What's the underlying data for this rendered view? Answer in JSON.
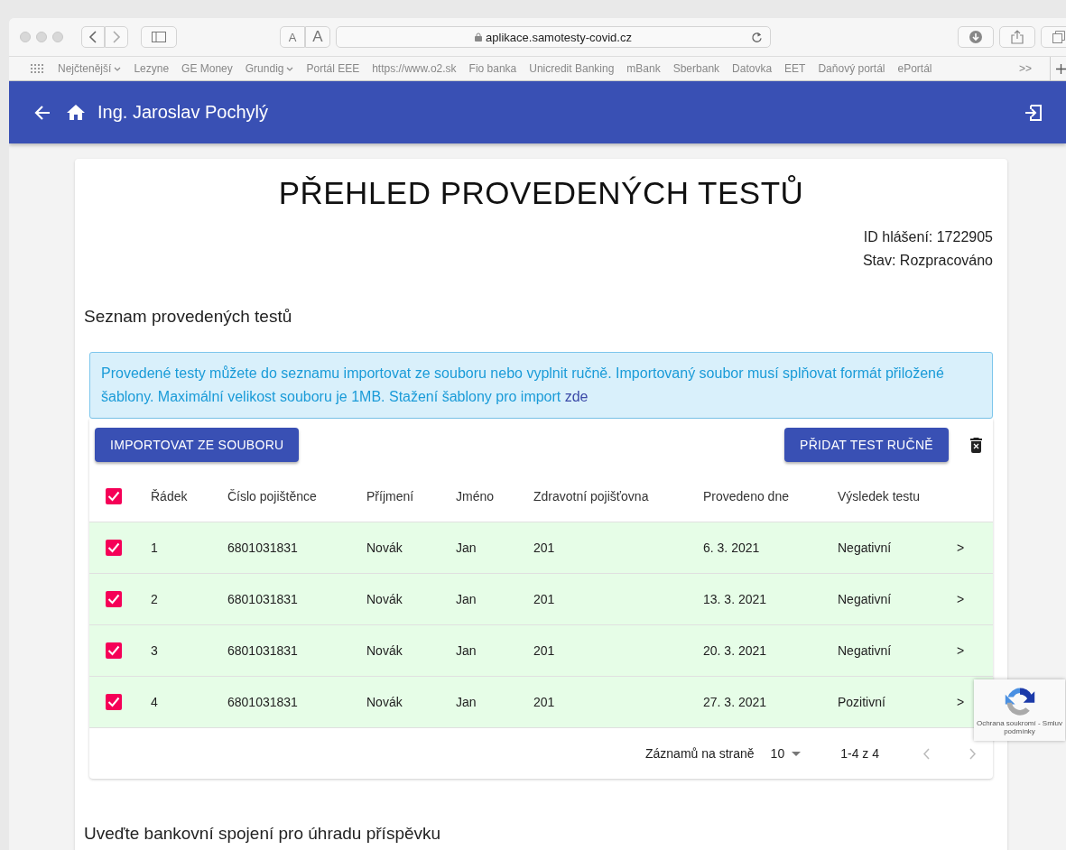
{
  "browser": {
    "url": "aplikace.samotesty-covid.cz",
    "font_small": "A",
    "font_large": "A",
    "bookmarks": [
      {
        "label": "Nejčtenější",
        "menu": true
      },
      {
        "label": "Lezyne",
        "menu": false
      },
      {
        "label": "GE Money",
        "menu": false
      },
      {
        "label": "Grundig",
        "menu": true
      },
      {
        "label": "Portál EEE",
        "menu": false
      },
      {
        "label": "https://www.o2.sk",
        "menu": false
      },
      {
        "label": "Fio banka",
        "menu": false
      },
      {
        "label": "Unicredit Banking",
        "menu": false
      },
      {
        "label": "mBank",
        "menu": false
      },
      {
        "label": "Sberbank",
        "menu": false
      },
      {
        "label": "Datovka",
        "menu": false
      },
      {
        "label": "EET",
        "menu": false
      },
      {
        "label": "Daňový portál",
        "menu": false
      },
      {
        "label": "ePortál",
        "menu": false
      }
    ],
    "more": ">>"
  },
  "header": {
    "user": "Ing. Jaroslav Pochylý"
  },
  "page": {
    "title": "PŘEHLED PROVEDENÝCH TESTŮ",
    "report_id": "ID hlášení: 1722905",
    "status": "Stav: Rozpracováno",
    "section_title": "Seznam provedených testů",
    "info": {
      "text": "Provedené testy můžete do seznamu importovat ze souboru nebo vyplnit ručně. Importovaný soubor musí splňovat formát přiložené šablony. Maximální velikost souboru je 1MB. Stažení šablony pro import ",
      "link": "zde"
    },
    "import_button": "IMPORTOVAT ZE SOUBORU",
    "add_button": "PŘIDAT TEST RUČNĚ",
    "table": {
      "all_checked": true,
      "columns": [
        "Řádek",
        "Číslo pojištěnce",
        "Příjmení",
        "Jméno",
        "Zdravotní pojišťovna",
        "Provedeno dne",
        "Výsledek testu"
      ],
      "rows": [
        {
          "checked": true,
          "cells": [
            "1",
            "6801031831",
            "Novák",
            "Jan",
            "201",
            "6. 3. 2021",
            "Negativní"
          ],
          "open": ">"
        },
        {
          "checked": true,
          "cells": [
            "2",
            "6801031831",
            "Novák",
            "Jan",
            "201",
            "13. 3. 2021",
            "Negativní"
          ],
          "open": ">"
        },
        {
          "checked": true,
          "cells": [
            "3",
            "6801031831",
            "Novák",
            "Jan",
            "201",
            "20. 3. 2021",
            "Negativní"
          ],
          "open": ">"
        },
        {
          "checked": true,
          "cells": [
            "4",
            "6801031831",
            "Novák",
            "Jan",
            "201",
            "27. 3. 2021",
            "Pozitivní"
          ],
          "open": ">"
        }
      ]
    },
    "pagination": {
      "label": "Záznamů na straně",
      "per_page": "10",
      "range": "1-4 z 4"
    },
    "next_section": "Uveďte bankovní spojení pro úhradu příspěvku"
  },
  "recaptcha": {
    "lines": [
      "Ochrana soukromí - Smluv",
      "podmínky"
    ]
  }
}
